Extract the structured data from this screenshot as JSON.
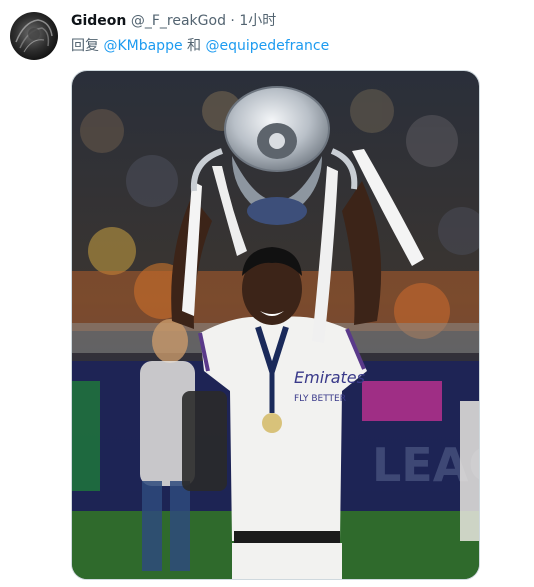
{
  "tweet": {
    "display_name": "Gideon",
    "handle": "@_F_reakGod",
    "separator": "·",
    "time": "1小时",
    "reply": {
      "prefix": "回复",
      "mention_1": "@KMbappe",
      "conjunction": "和",
      "mention_2": "@equipedefrance"
    },
    "media": {
      "shirt_text_1": "Emirates",
      "shirt_text_2": "FLY BETTER",
      "board_text": "LEAG"
    }
  },
  "colors": {
    "link": "#1d9bf0",
    "secondary_text": "#536471",
    "primary_text": "#0f1419"
  },
  "icons": {
    "avatar": "avatar-image"
  }
}
